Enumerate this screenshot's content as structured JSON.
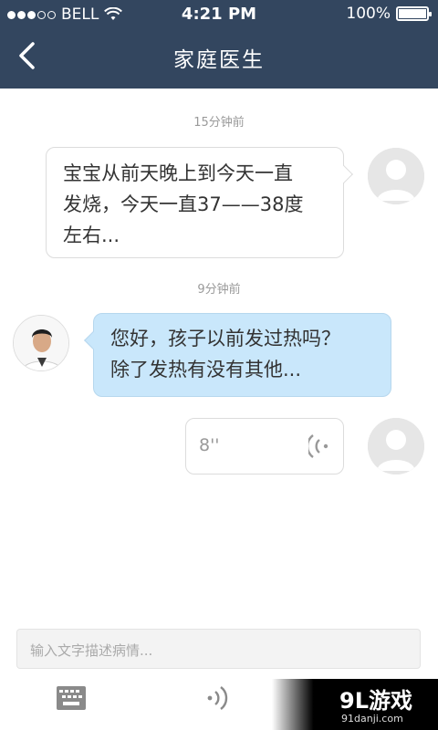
{
  "status_bar": {
    "carrier": "BELL",
    "time": "4:21 PM",
    "battery": "100%"
  },
  "nav": {
    "title": "家庭医生"
  },
  "chat": {
    "messages": [
      {
        "timestamp": "15分钟前",
        "sender": "user",
        "lines": [
          "宝宝从前天晚上到今天一直",
          "发烧，今天一直37——38度",
          "左右..."
        ]
      },
      {
        "timestamp": "9分钟前",
        "sender": "doctor",
        "lines": [
          "您好，孩子以前发过热吗？",
          "除了发热有没有其他..."
        ]
      },
      {
        "sender": "user",
        "type": "voice",
        "duration": "8''"
      }
    ]
  },
  "composer": {
    "placeholder": "输入文字描述病情..."
  },
  "watermark": {
    "main": "9L游戏",
    "sub": "91danji.com"
  }
}
